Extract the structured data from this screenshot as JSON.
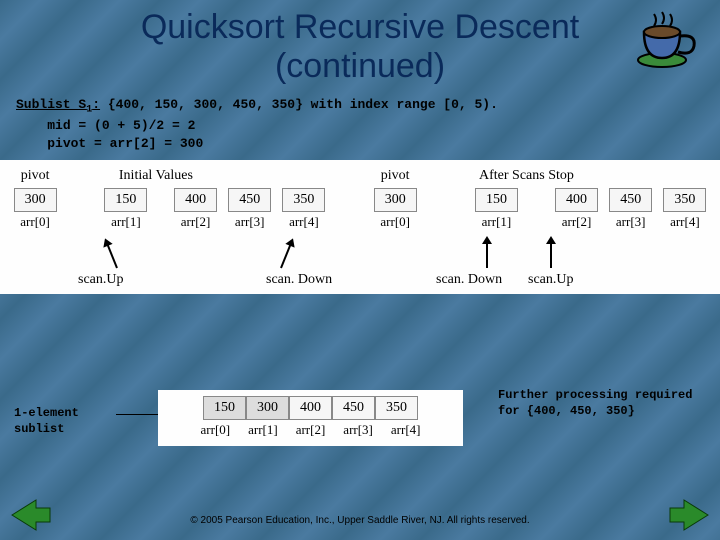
{
  "title_line1": "Quicksort Recursive Descent",
  "title_line2": "(continued)",
  "sublist": {
    "label": "Sublist S",
    "sub": "1",
    "colon": ":",
    "set_text": " {400, 150, 300, 450, 350} with index range [0, 5).",
    "mid_line": "mid = (0 + 5)/2 = 2",
    "pivot_line": "pivot = arr[2] = 300"
  },
  "block1": {
    "left": {
      "pivot_label": "pivot",
      "header": "Initial Values",
      "pivot_value": "300",
      "cells": [
        "150",
        "400",
        "450",
        "350"
      ],
      "idx": [
        "arr[0]",
        "arr[1]",
        "arr[2]",
        "arr[3]",
        "arr[4]"
      ],
      "scanUp": "scan.Up",
      "scanDown": "scan. Down"
    },
    "right": {
      "pivot_label": "pivot",
      "header": "After Scans Stop",
      "pivot_value": "300",
      "cells": [
        "150",
        "400",
        "450",
        "350"
      ],
      "idx": [
        "arr[0]",
        "arr[1]",
        "arr[2]",
        "arr[3]",
        "arr[4]"
      ],
      "scanUp": "scan.Up",
      "scanDown": "scan. Down"
    }
  },
  "block2": {
    "cells": [
      "150",
      "300",
      "400",
      "450",
      "350"
    ],
    "idx": [
      "arr[0]",
      "arr[1]",
      "arr[2]",
      "arr[3]",
      "arr[4]"
    ]
  },
  "note_left": "1-element sublist",
  "note_right": "Further processing required for {400, 450, 350}",
  "copyright": "© 2005 Pearson Education, Inc., Upper Saddle River, NJ. All rights reserved."
}
